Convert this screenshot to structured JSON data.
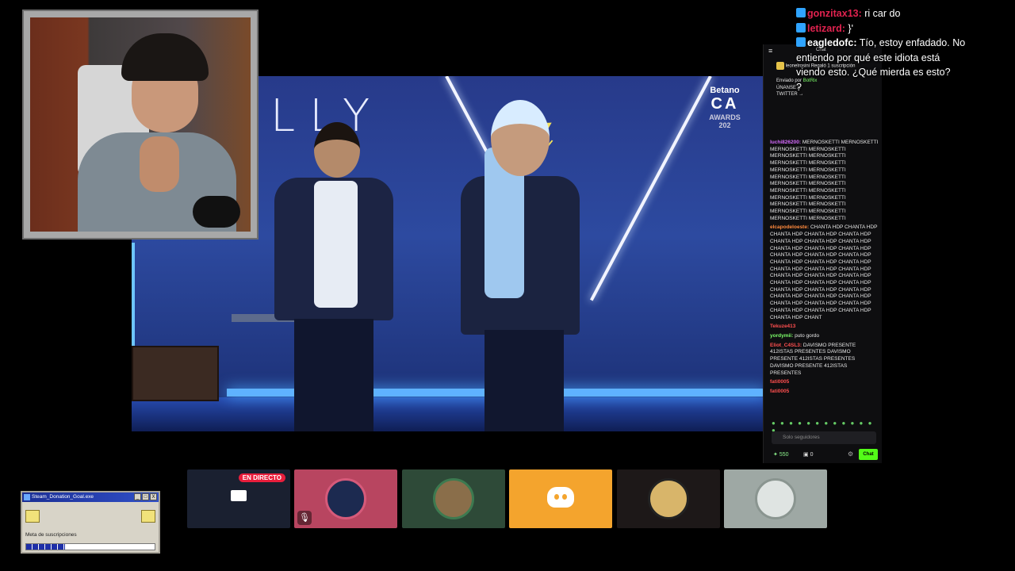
{
  "stage": {
    "backdrop_text": "LLY",
    "sponsor_name": "Betano",
    "sponsor_award": "CA",
    "sponsor_sub": "AWARDS",
    "sponsor_year": "202"
  },
  "overlay_chat": [
    {
      "user": "",
      "text": "",
      "color": "#e91e3c"
    },
    {
      "user": "gonzitax13:",
      "text": "ri car do",
      "color": "#e0224f"
    },
    {
      "user": "letizard:",
      "text": "}'",
      "color": "#e0224f"
    },
    {
      "user": "eagledofc:",
      "text": "Tío, estoy enfadado. No",
      "color": "#ffffff"
    },
    {
      "user": "",
      "text": "entiendo por qué este idiota está",
      "color": "#ffffff"
    },
    {
      "user": "",
      "text": "viendo esto. ¿Qué mierda es esto?",
      "color": "#ffffff"
    },
    {
      "user": "",
      "text": "?",
      "color": "#ffffff"
    }
  ],
  "chat_panel": {
    "header_title": "Chat",
    "gift_user": "leonelrosini",
    "gift_text": "Regaló 1 suscripción",
    "pinned_by": "Enviado por",
    "pinned_user": "BotRix",
    "pinned_text": "ÚNANSE A",
    "pinned_text_2": "TWITTER →",
    "messages": [
      {
        "user": "luchi826200:",
        "color": "#d76cff",
        "text": "MERNOSKETTI MERNOSKETTI MERNOSKETTI MERNOSKETTI MERNOSKETTI MERNOSKETTI MERNOSKETTI MERNOSKETTI MERNOSKETTI MERNOSKETTI MERNOSKETTI MERNOSKETTI MERNOSKETTI MERNOSKETTI MERNOSKETTI MERNOSKETTI MERNOSKETTI MERNOSKETTI MERNOSKETTI MERNOSKETTI MERNOSKETTI MERNOSKETTI MERNOSKETTI MERNOSKETTI"
      },
      {
        "user": "elcapodeloeste:",
        "color": "#ff8a3d",
        "text": "CHANTA HDP CHANTA HDP CHANTA HDP CHANTA HDP CHANTA HDP CHANTA HDP CHANTA HDP CHANTA HDP CHANTA HDP CHANTA HDP CHANTA HDP CHANTA HDP CHANTA HDP CHANTA HDP CHANTA HDP CHANTA HDP CHANTA HDP CHANTA HDP CHANTA HDP CHANTA HDP CHANTA HDP CHANTA HDP CHANTA HDP CHANTA HDP CHANTA HDP CHANTA HDP CHANTA HDP CHANTA HDP CHANTA HDP CHANTA HDP CHANTA HDP CHANTA HDP CHANTA HDP CHANTA HDP CHANTA HDP CHANTA HDP CHANTA HDP CHANTA HDP CHANTA HDP CHANT"
      },
      {
        "user": "Tekuze413",
        "color": "#ff4f4f",
        "text": ""
      },
      {
        "user": "yordymii:",
        "color": "#7dff6a",
        "text": "puto gordo"
      },
      {
        "user": "Eliot_C4SL3:",
        "color": "#ff4f4f",
        "text": "DAVISMO PRESENTE 412ISTAS PRESENTES DAVISMO PRESENTE 412ISTAS PRESENTES DAVISMO PRESENTE 412ISTAS PRESENTES"
      },
      {
        "user": "fati0005",
        "color": "#ff4f4f",
        "text": ""
      },
      {
        "user": "fati0005",
        "color": "#ff4f4f",
        "text": ""
      }
    ],
    "input_placeholder": "Solo seguidores",
    "points": "550",
    "drops": "0",
    "chat_button": "Chat"
  },
  "tiles": [
    {
      "name": "screen-share",
      "bg": "#1a2030",
      "live_label": "EN DIRECTO"
    },
    {
      "name": "participant-1",
      "bg": "#b84560"
    },
    {
      "name": "participant-2",
      "bg": "#2e4a38"
    },
    {
      "name": "discord",
      "bg": "#f4a42d"
    },
    {
      "name": "participant-3",
      "bg": "#1d1818"
    },
    {
      "name": "participant-4",
      "bg": "#9ea8a4"
    }
  ],
  "donation_window": {
    "title": "Steam_Donation_Goal.exe",
    "goal_label": "Meta de suscripciones",
    "progress": 0.3,
    "btn_min": "_",
    "btn_max": "□",
    "btn_close": "X"
  }
}
